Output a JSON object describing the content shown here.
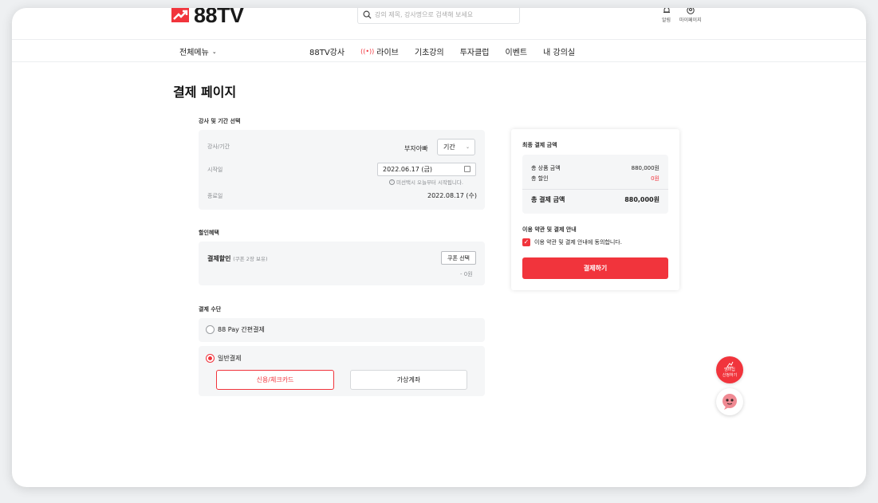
{
  "brand": {
    "logo_text": "88TV",
    "accent": "#f1343c"
  },
  "header": {
    "search_placeholder": "강의 제목, 강사명으로 검색해 보세요",
    "alarm_label": "알림",
    "mypage_label": "마이페이지"
  },
  "nav": {
    "all_menu": "전체메뉴",
    "items": [
      "88TV강사",
      "라이브",
      "기초강의",
      "투자클럽",
      "이벤트",
      "내 강의실"
    ]
  },
  "page": {
    "title": "결제 페이지"
  },
  "course": {
    "section_label": "강사 및 기간 선택",
    "instructor_label": "강사/기간",
    "instructor_name": "부자아빠",
    "period_select": "기간",
    "start_label": "시작일",
    "start_date": "2022.06.17 (금)",
    "start_note": "미선택시 오늘부터 시작됩니다.",
    "end_label": "종료일",
    "end_date": "2022.08.17 (수)"
  },
  "discount": {
    "section_label": "할인혜택",
    "label": "결제할인",
    "coupon_info": "(쿠폰 2장 보유)",
    "coupon_button": "쿠폰 선택",
    "amount": "- 0원"
  },
  "payment_method": {
    "section_label": "결제 수단",
    "option_easy": "88 Pay 간편결제",
    "option_general": "일반결제",
    "selected": "일반결제",
    "card_button": "신용/체크카드",
    "vaccount_button": "가상계좌"
  },
  "summary": {
    "title": "최종 결제 금액",
    "product_label": "총 상품 금액",
    "product_amount": "880,000원",
    "discount_label": "총 할인",
    "discount_amount": "0원",
    "total_label": "총 결제 금액",
    "total_amount": "880,000원",
    "terms_title": "이용 약관 및 결제 안내",
    "terms_agree": "이용 약관 및 결제 안내에 동의합니다.",
    "terms_checked": true,
    "pay_button": "결제하기"
  },
  "floating": {
    "membership_line1": "멤버십",
    "membership_line2": "신청하기"
  }
}
